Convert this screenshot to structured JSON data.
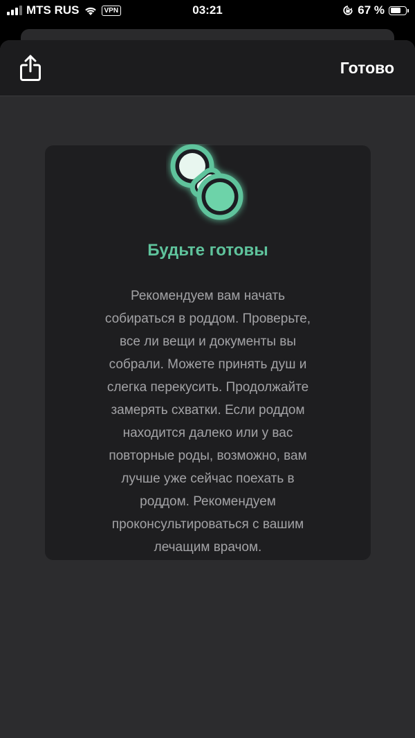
{
  "status_bar": {
    "carrier": "MTS RUS",
    "vpn": "VPN",
    "time": "03:21",
    "battery": "67 %",
    "battery_level": 0.67
  },
  "header": {
    "share_icon": "share-icon",
    "done_label": "Готово"
  },
  "card": {
    "icon": "pacifier-icon",
    "accent_color": "#5fc39c",
    "title": "Будьте готовы",
    "body": "Рекомендуем вам начать\nсобираться в роддом. Проверьте,\nвсе ли вещи и документы вы\nсобрали. Можете принять душ и\nслегка перекусить. Продолжайте\nзамерять схватки. Если роддом\nнаходится далеко или у вас\nповторные роды, возможно, вам\nлучше уже сейчас поехать в\nроддом. Рекомендуем\nпроконсультироваться с вашим\nлечащим врачом."
  }
}
